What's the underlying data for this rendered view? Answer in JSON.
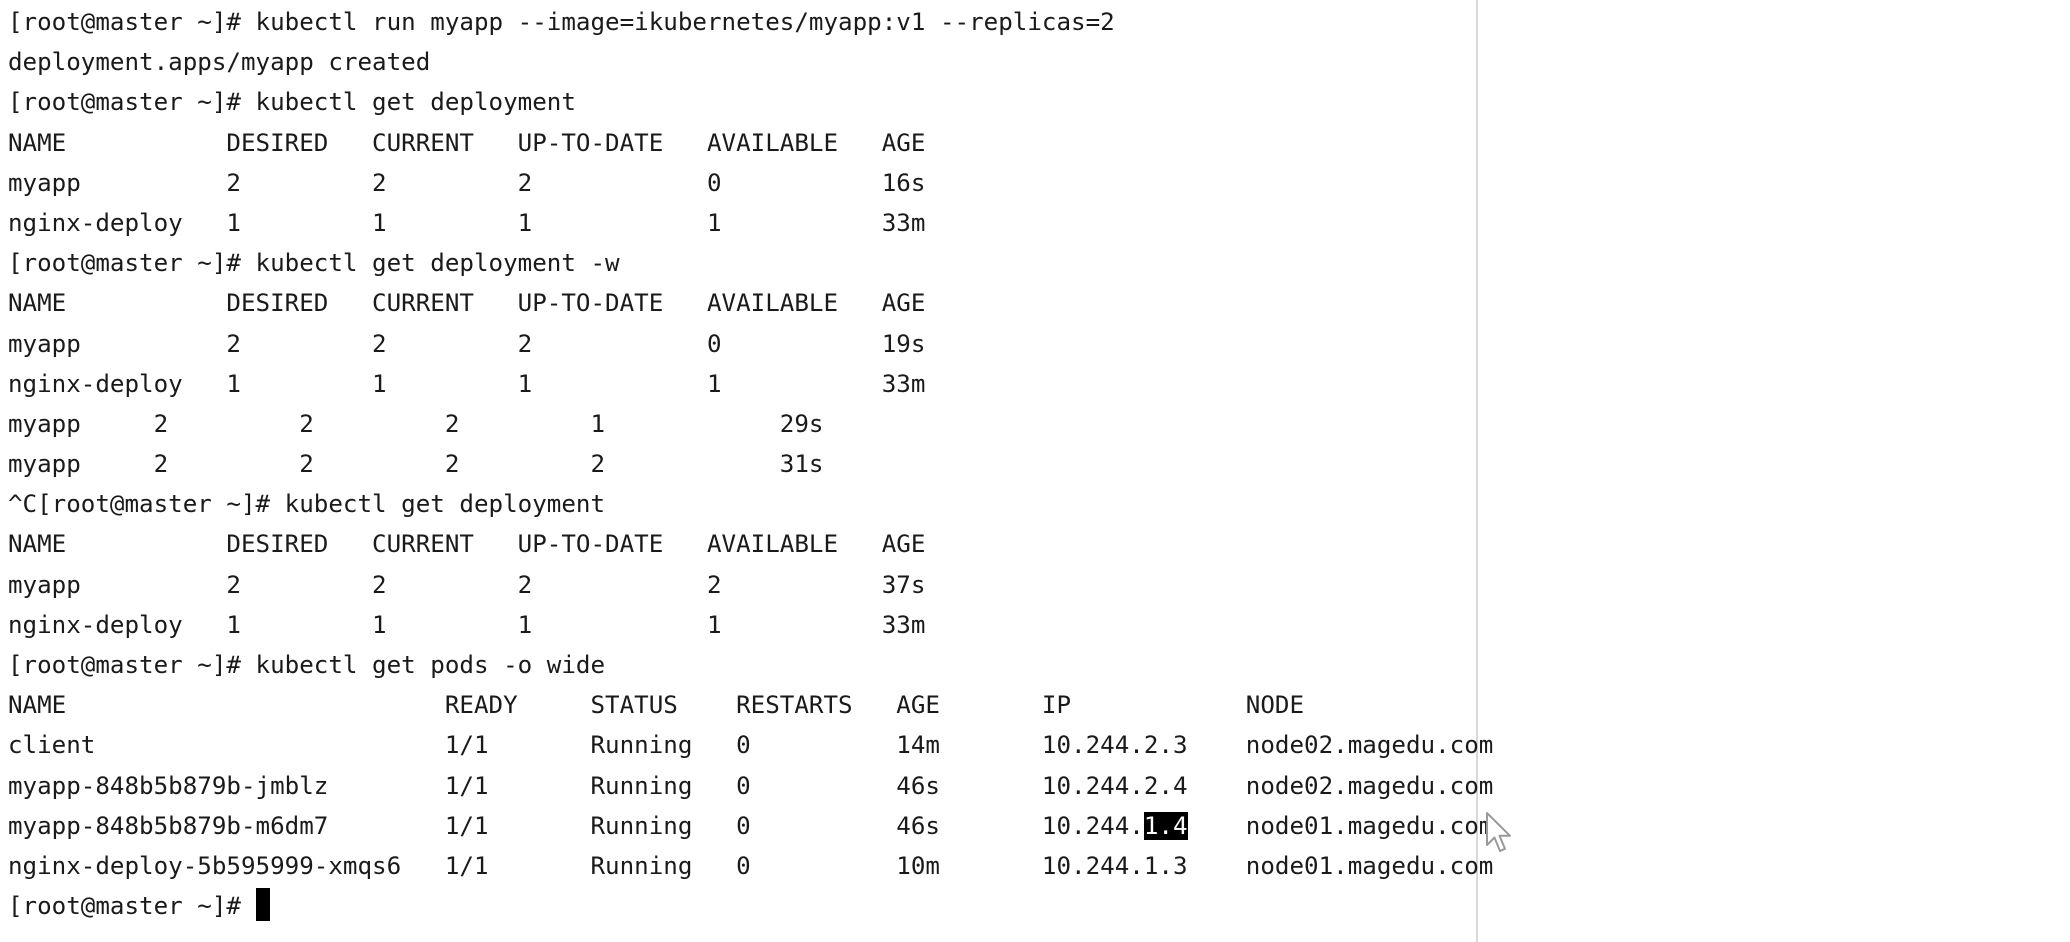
{
  "terminal": {
    "lines": [
      {
        "segs": [
          "[root@master ~]# kubectl run myapp --image=ikubernetes/myapp:v1 --replicas=2"
        ]
      },
      {
        "segs": [
          "deployment.apps/myapp created"
        ]
      },
      {
        "segs": [
          "[root@master ~]# kubectl get deployment"
        ]
      },
      {
        "segs": [
          "NAME           DESIRED   CURRENT   UP-TO-DATE   AVAILABLE   AGE"
        ]
      },
      {
        "segs": [
          "myapp          2         2         2            0           16s"
        ]
      },
      {
        "segs": [
          "nginx-deploy   1         1         1            1           33m"
        ]
      },
      {
        "segs": [
          "[root@master ~]# kubectl get deployment -w"
        ]
      },
      {
        "segs": [
          "NAME           DESIRED   CURRENT   UP-TO-DATE   AVAILABLE   AGE"
        ]
      },
      {
        "segs": [
          "myapp          2         2         2            0           19s"
        ]
      },
      {
        "segs": [
          "nginx-deploy   1         1         1            1           33m"
        ]
      },
      {
        "segs": [
          "myapp     2         2         2         1            29s"
        ]
      },
      {
        "segs": [
          "myapp     2         2         2         2            31s"
        ]
      },
      {
        "segs": [
          "^C[root@master ~]# kubectl get deployment"
        ]
      },
      {
        "segs": [
          "NAME           DESIRED   CURRENT   UP-TO-DATE   AVAILABLE   AGE"
        ]
      },
      {
        "segs": [
          "myapp          2         2         2            2           37s"
        ]
      },
      {
        "segs": [
          "nginx-deploy   1         1         1            1           33m"
        ]
      },
      {
        "segs": [
          "[root@master ~]# kubectl get pods -o wide"
        ]
      },
      {
        "segs": [
          "NAME                          READY     STATUS    RESTARTS   AGE       IP            NODE"
        ]
      },
      {
        "segs": [
          "client                        1/1       Running   0          14m       10.244.2.3    node02.magedu.com"
        ]
      },
      {
        "segs": [
          "myapp-848b5b879b-jmblz        1/1       Running   0          46s       10.244.2.4    node02.magedu.com"
        ]
      },
      {
        "segs": [
          "myapp-848b5b879b-m6dm7        1/1       Running   0          46s       10.244.",
          "1.4",
          "    node01.magedu.com"
        ]
      },
      {
        "segs": [
          "nginx-deploy-5b595999-xmqs6   1/1       Running   0          10m       10.244.1.3    node01.magedu.com"
        ]
      }
    ],
    "selection": {
      "line": 20,
      "seg": 1
    },
    "prompt": "[root@master ~]# "
  }
}
